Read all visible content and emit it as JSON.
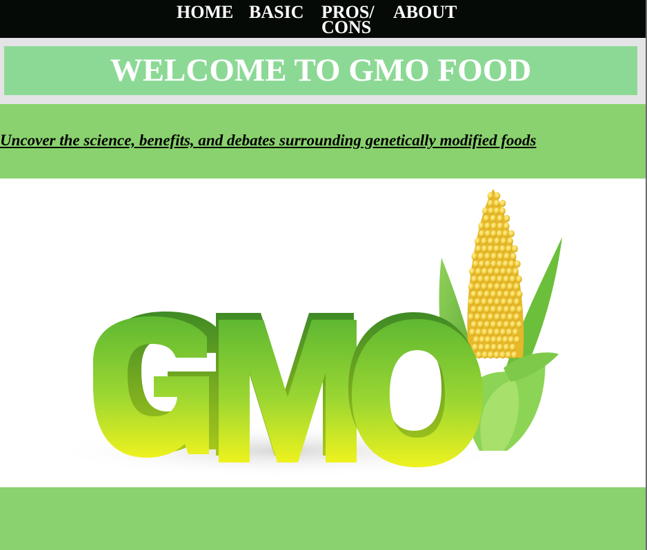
{
  "nav": {
    "items": [
      {
        "label": "HOME"
      },
      {
        "label": "BASIC"
      },
      {
        "label": "PROS/ CONS"
      },
      {
        "label": "ABOUT"
      }
    ]
  },
  "banner": {
    "title": "WELCOME TO GMO FOOD"
  },
  "tagline": {
    "text": "Uncover the science, benefits, and debates surrounding genetically modified foods"
  },
  "hero": {
    "image_text": "GMO",
    "image_subject": "corn-cob-icon"
  },
  "colors": {
    "nav_bg": "#060a07",
    "banner_outer": "#e4e4e6",
    "banner_inner": "#8cd996",
    "page_green": "#8ad26f",
    "letters_green": "#5fb832",
    "letters_yellow": "#e6f01e",
    "corn_yellow": "#f2cc3c"
  }
}
